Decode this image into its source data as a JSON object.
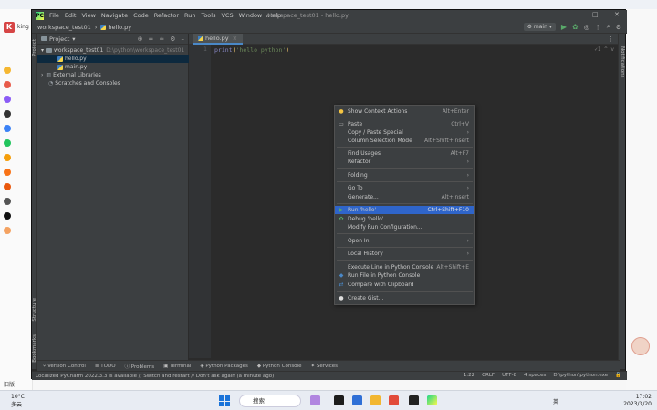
{
  "window": {
    "title": "workspace_test01 - hello.py",
    "breadcrumb": [
      "workspace_test01",
      "hello.py"
    ],
    "menu": [
      "File",
      "Edit",
      "View",
      "Navigate",
      "Code",
      "Refactor",
      "Run",
      "Tools",
      "VCS",
      "Window",
      "Help"
    ],
    "run_config": "main"
  },
  "project_panel": {
    "title": "Project",
    "tree": [
      {
        "label": "workspace_test01",
        "path": "D:\\python\\workspace_test01"
      },
      {
        "label": "hello.py"
      },
      {
        "label": "main.py"
      },
      {
        "label": "External Libraries"
      },
      {
        "label": "Scratches and Consoles"
      }
    ]
  },
  "left_strip": {
    "project": "Project",
    "structure": "Structure",
    "bookmarks": "Bookmarks"
  },
  "right_strip": {
    "notifications": "Notifications"
  },
  "editor": {
    "tab": "hello.py",
    "line_number": "1",
    "code_keyword": "print",
    "code_string": "'hello python'",
    "open_paren": "(",
    "close_paren": ")"
  },
  "context_menu": {
    "items": [
      {
        "label": "Show Context Actions",
        "shortcut": "Alt+Enter",
        "icon": "bulb-icon"
      },
      {
        "label": "Paste",
        "shortcut": "Ctrl+V",
        "icon": "clipboard-icon"
      },
      {
        "label": "Copy / Paste Special",
        "shortcut": "›"
      },
      {
        "label": "Column Selection Mode",
        "shortcut": "Alt+Shift+Insert"
      },
      {
        "label": "Find Usages",
        "shortcut": "Alt+F7"
      },
      {
        "label": "Refactor",
        "shortcut": "›"
      },
      {
        "label": "Folding",
        "shortcut": "›"
      },
      {
        "label": "Go To",
        "shortcut": "›"
      },
      {
        "label": "Generate...",
        "shortcut": "Alt+Insert"
      },
      {
        "label": "Run 'hello'",
        "shortcut": "Ctrl+Shift+F10",
        "icon": "run-icon"
      },
      {
        "label": "Debug 'hello'",
        "shortcut": "",
        "icon": "debug-icon"
      },
      {
        "label": "Modify Run Configuration...",
        "shortcut": ""
      },
      {
        "label": "Open In",
        "shortcut": "›"
      },
      {
        "label": "Local History",
        "shortcut": "›"
      },
      {
        "label": "Execute Line in Python Console",
        "shortcut": "Alt+Shift+E"
      },
      {
        "label": "Run File in Python Console",
        "shortcut": "",
        "icon": "python-console-icon"
      },
      {
        "label": "Compare with Clipboard",
        "shortcut": "",
        "icon": "compare-icon"
      },
      {
        "label": "Create Gist...",
        "shortcut": "",
        "icon": "github-icon"
      }
    ]
  },
  "tool_windows": [
    "Version Control",
    "TODO",
    "Problems",
    "Terminal",
    "Python Packages",
    "Python Console",
    "Services"
  ],
  "status": {
    "message": "Localized PyCharm 2022.3.3 is available // Switch and restart // Don't ask again (a minute ago)",
    "position": "1:22",
    "line_sep": "CRLF",
    "encoding": "UTF-8",
    "indent": "4 spaces",
    "interpreter": "D:\\python\\python.exe"
  },
  "taskbar": {
    "weather_temp": "10°C",
    "weather_desc": "多云",
    "search": "搜索",
    "lang": "英",
    "time": "17:02",
    "date": "2023/3/20"
  },
  "browser": {
    "sidebar_title": "king",
    "sidebar_tail": "旧版"
  }
}
